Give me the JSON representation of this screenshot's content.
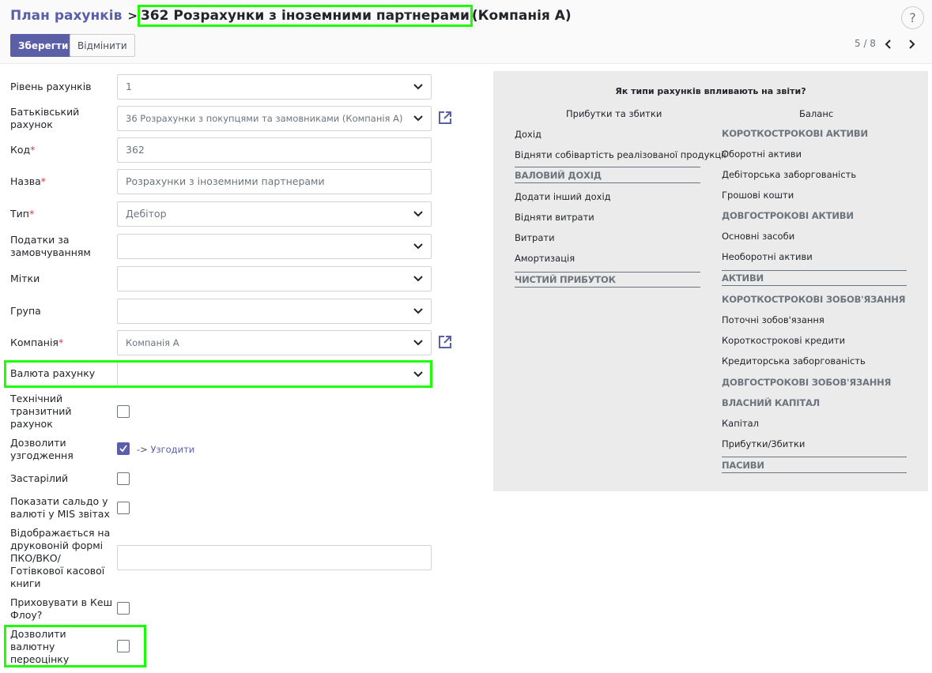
{
  "breadcrumb": {
    "parent": "План рахунків",
    "separator": ">",
    "current": "362 Розрахунки з іноземними партнерами",
    "suffix": "(Компанія А)"
  },
  "help": {
    "label": "?"
  },
  "toolbar": {
    "save_label": "Зберегти",
    "discard_label": "Відмінити"
  },
  "pager": {
    "text": "5 / 8"
  },
  "form": {
    "level": {
      "label": "Рівень рахунків",
      "value": "1"
    },
    "parent": {
      "label": "Батьківський рахунок",
      "value": "36 Розрахунки з покупцями та замовниками (Компанія А)"
    },
    "code": {
      "label": "Код",
      "value": "362"
    },
    "name": {
      "label": "Назва",
      "value": "Розрахунки з іноземними партнерами"
    },
    "type": {
      "label": "Тип",
      "value": "Дебітор"
    },
    "taxes": {
      "label": "Податки за замовчуванням",
      "value": ""
    },
    "tags": {
      "label": "Мітки",
      "value": ""
    },
    "group": {
      "label": "Група",
      "value": ""
    },
    "company": {
      "label": "Компанія",
      "value": "Компанія А"
    },
    "currency": {
      "label": "Валюта рахунку",
      "value": ""
    },
    "transit": {
      "label": "Технічний транзитний рахунок",
      "checked": false
    },
    "reconcile": {
      "label": "Дозволити узгодження",
      "checked": true,
      "link_arrow": "->",
      "link": "Узгодити"
    },
    "deprecated": {
      "label": "Застарілий",
      "checked": false
    },
    "mis_balance": {
      "label": "Показати сальдо у валюті у MIS звітах",
      "checked": false
    },
    "print_form": {
      "label": "Відображається на друковоній формі ПКО/ВКО/Готівкової касової книги",
      "value": ""
    },
    "hide_cashflow": {
      "label": "Приховувати в Кеш Флоу?",
      "checked": false
    },
    "revaluation": {
      "label": "Дозволити валютну переоцінку",
      "checked": false
    },
    "required_mark": "*"
  },
  "info": {
    "title": "Як типи рахунків впливають на звіти?",
    "pl_header": "Прибутки та збитки",
    "balance_header": "Баланс",
    "pl": {
      "income": "Дохід",
      "cost_of_sales": "Відняти собівартість реалізованої продукції",
      "gross_profit": "ВАЛОВИЙ ДОХІД",
      "other_income": "Додати інший дохід",
      "expenses_minus": "Відняти витрати",
      "expenses": "Витрати",
      "depreciation": "Амортизація",
      "net_profit": "ЧИСТИЙ ПРИБУТОК"
    },
    "balance": {
      "current_assets_h": "КОРОТКОСТРОКОВІ АКТИВИ",
      "working_capital": "Оборотні активи",
      "receivables": "Дебіторська заборгованість",
      "cash": "Грошові кошти",
      "long_assets_h": "ДОВГОСТРОКОВІ АКТИВИ",
      "fixed_assets": "Основні засоби",
      "non_current": "Необоротні активи",
      "assets_h": "АКТИВИ",
      "short_liab_h": "КОРОТКОСТРОКОВІ ЗОБОВ'ЯЗАННЯ",
      "current_liab": "Поточні зобов'язання",
      "short_loans": "Короткострокові кредити",
      "payables": "Кредиторська заборгованість",
      "long_liab_h": "ДОВГОСТРОКОВІ ЗОБОВ'ЯЗАННЯ",
      "equity_h": "ВЛАСНИЙ КАПІТАЛ",
      "capital": "Капітал",
      "profit_loss": "Прибутки/Збитки",
      "liabilities_h": "ПАСИВИ"
    }
  },
  "colors": {
    "brand": "#5a5fa8",
    "highlight": "#1bff00",
    "required": "#dc3545"
  }
}
